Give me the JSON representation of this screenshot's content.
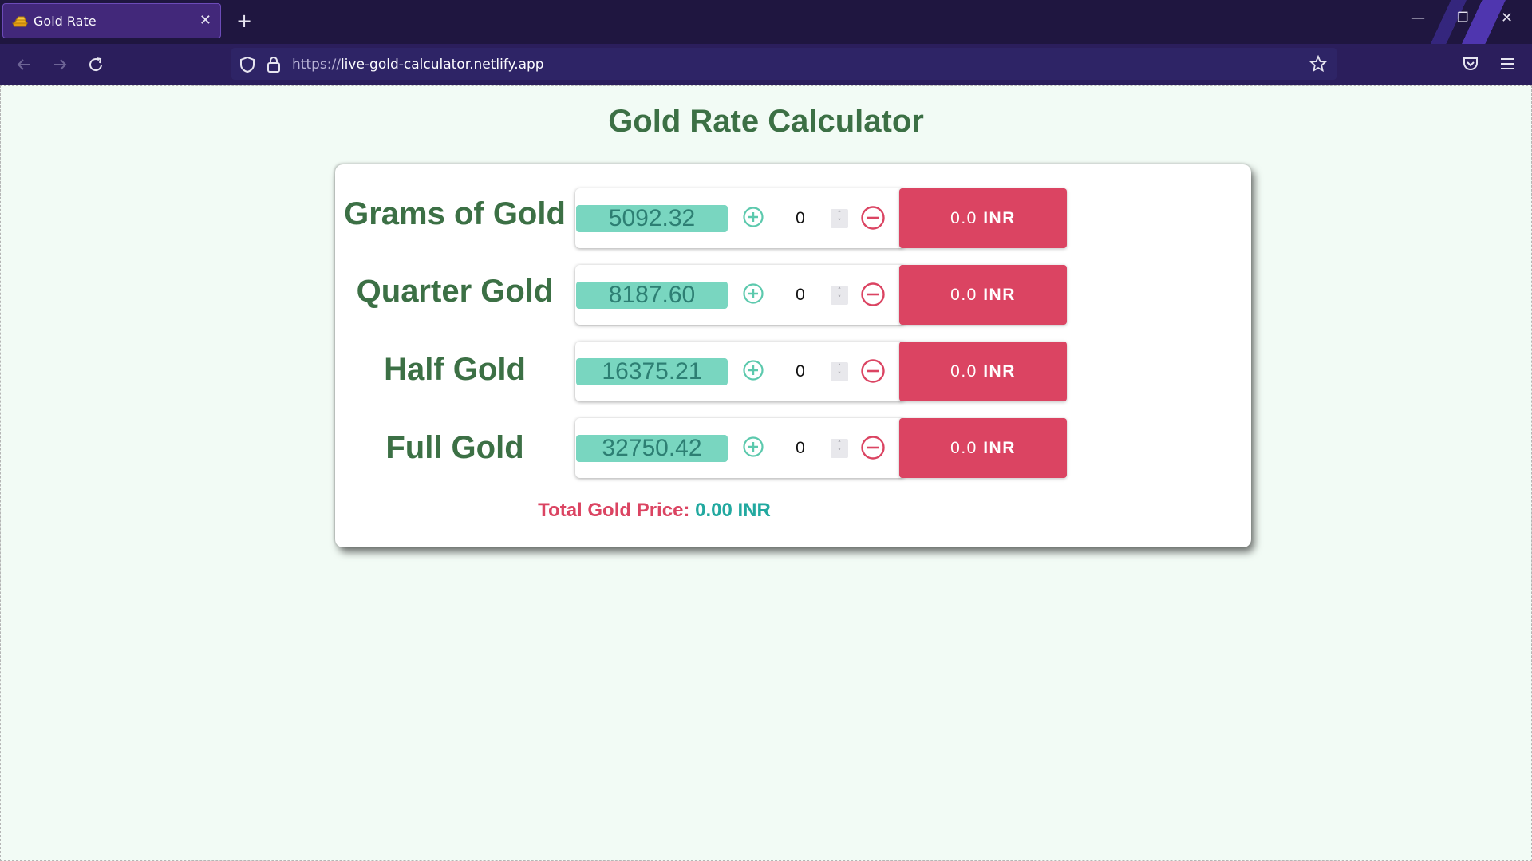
{
  "browser": {
    "tab_title": "Gold Rate",
    "url_scheme": "https://",
    "url_host": "live-gold-calculator.netlify.app"
  },
  "page": {
    "title": "Gold Rate Calculator",
    "rows": [
      {
        "label": "Grams of Gold",
        "rate": "5092.32",
        "quantity": "0",
        "amount": "0.0",
        "currency": "INR"
      },
      {
        "label": "Quarter Gold",
        "rate": "8187.60",
        "quantity": "0",
        "amount": "0.0",
        "currency": "INR"
      },
      {
        "label": "Half Gold",
        "rate": "16375.21",
        "quantity": "0",
        "amount": "0.0",
        "currency": "INR"
      },
      {
        "label": "Full Gold",
        "rate": "32750.42",
        "quantity": "0",
        "amount": "0.0",
        "currency": "INR"
      }
    ],
    "total_label": "Total Gold Price:",
    "total_value": "0.00 INR"
  },
  "colors": {
    "heading": "#3c7045",
    "rate_pill": "#79d6c0",
    "result_button": "#db4462",
    "total_value": "#22a9a0"
  }
}
